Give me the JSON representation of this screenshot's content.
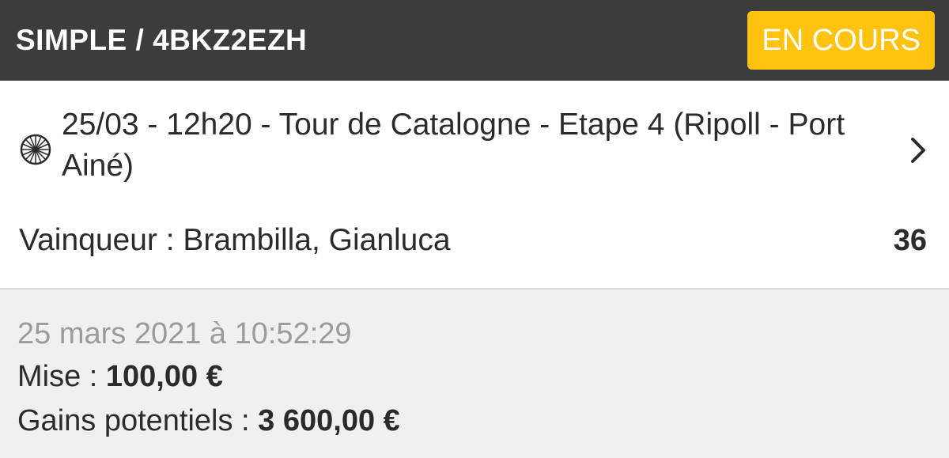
{
  "header": {
    "title": "SIMPLE / 4BKZ2EZH",
    "status": "EN COURS"
  },
  "event": {
    "icon": "bicycle-wheel-icon",
    "title": "25/03 - 12h20 - Tour de Catalogne - Etape 4 (Ripoll - Port Ainé)",
    "selection": "Vainqueur : Brambilla, Gianluca",
    "odds": "36"
  },
  "details": {
    "placed_at": "25 mars 2021 à 10:52:29",
    "stake_label": "Mise : ",
    "stake_value": "100,00 €",
    "potential_label": "Gains potentiels : ",
    "potential_value": "3 600,00 €"
  },
  "colors": {
    "header_bg": "#3c3c3c",
    "badge_bg": "#ffc20e"
  }
}
